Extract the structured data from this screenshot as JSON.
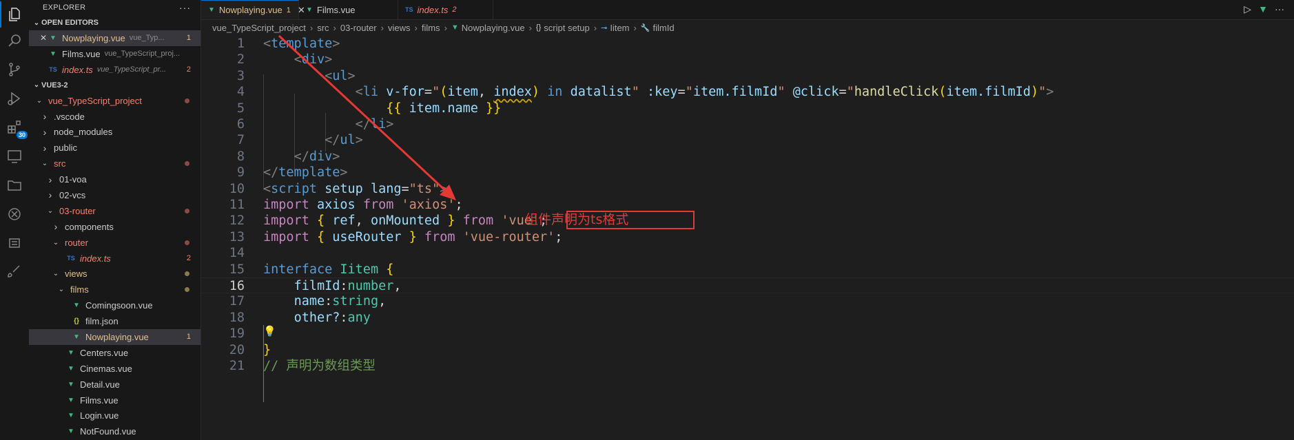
{
  "explorer": {
    "title": "EXPLORER",
    "more": "···",
    "open_editors_title": "OPEN EDITORS",
    "open_editors": [
      {
        "name": "Nowplaying.vue",
        "desc": "vue_Typ...",
        "count": "1",
        "icon": "vue-icon",
        "status": "mod",
        "close": "✕"
      },
      {
        "name": "Films.vue",
        "desc": "vue_TypeScript_proj...",
        "count": "",
        "icon": "vue-icon",
        "status": "none"
      },
      {
        "name": "index.ts",
        "desc": "vue_TypeScript_pr...",
        "count": "2",
        "icon": "ts-icon",
        "status": "err"
      }
    ],
    "workspace_title": "VUE3-2",
    "tree": [
      {
        "name": "vue_TypeScript_project",
        "depth": 0,
        "twist": "v",
        "color": "err",
        "marker": "dot"
      },
      {
        "name": ".vscode",
        "depth": 1,
        "twist": ">",
        "color": "none"
      },
      {
        "name": "node_modules",
        "depth": 1,
        "twist": ">",
        "color": "none"
      },
      {
        "name": "public",
        "depth": 1,
        "twist": ">",
        "color": "none"
      },
      {
        "name": "src",
        "depth": 1,
        "twist": "v",
        "color": "err",
        "marker": "dot"
      },
      {
        "name": "01-voa",
        "depth": 2,
        "twist": ">",
        "color": "none"
      },
      {
        "name": "02-vcs",
        "depth": 2,
        "twist": ">",
        "color": "none"
      },
      {
        "name": "03-router",
        "depth": 2,
        "twist": "v",
        "color": "err",
        "marker": "dot"
      },
      {
        "name": "components",
        "depth": 3,
        "twist": ">",
        "color": "none"
      },
      {
        "name": "router",
        "depth": 3,
        "twist": "v",
        "color": "err",
        "marker": "dot"
      },
      {
        "name": "index.ts",
        "depth": 4,
        "twist": "",
        "icon": "ts-icon",
        "color": "err",
        "count": "2"
      },
      {
        "name": "views",
        "depth": 3,
        "twist": "v",
        "color": "mod",
        "marker": "dot-mod"
      },
      {
        "name": "films",
        "depth": 4,
        "twist": "v",
        "color": "mod",
        "marker": "dot-mod"
      },
      {
        "name": "Comingsoon.vue",
        "depth": 5,
        "twist": "",
        "icon": "vue-icon",
        "color": "none"
      },
      {
        "name": "film.json",
        "depth": 5,
        "twist": "",
        "icon": "json-icon",
        "color": "none"
      },
      {
        "name": "Nowplaying.vue",
        "depth": 5,
        "twist": "",
        "icon": "vue-icon",
        "color": "mod",
        "count": "1",
        "selected": true
      },
      {
        "name": "Centers.vue",
        "depth": 4,
        "twist": "",
        "icon": "vue-icon",
        "color": "none"
      },
      {
        "name": "Cinemas.vue",
        "depth": 4,
        "twist": "",
        "icon": "vue-icon",
        "color": "none"
      },
      {
        "name": "Detail.vue",
        "depth": 4,
        "twist": "",
        "icon": "vue-icon",
        "color": "none"
      },
      {
        "name": "Films.vue",
        "depth": 4,
        "twist": "",
        "icon": "vue-icon",
        "color": "none"
      },
      {
        "name": "Login.vue",
        "depth": 4,
        "twist": "",
        "icon": "vue-icon",
        "color": "none"
      },
      {
        "name": "NotFound.vue",
        "depth": 4,
        "twist": "",
        "icon": "vue-icon",
        "color": "none"
      }
    ]
  },
  "activity_bar": {
    "icons": [
      "files-icon",
      "search-icon",
      "source-control-icon",
      "run-debug-icon",
      "extensions-icon",
      "remote-explorer-icon",
      "folder-icon",
      "openai-icon",
      "list-icon",
      "brush-icon"
    ],
    "extensions_badge": "30"
  },
  "tabs": [
    {
      "label": "Nowplaying.vue",
      "count": "1",
      "close": "✕",
      "icon": "vue-icon",
      "active": true,
      "status": "mod"
    },
    {
      "label": "Films.vue",
      "count": "",
      "icon": "vue-icon",
      "active": false,
      "status": "none"
    },
    {
      "label": "index.ts",
      "count": "2",
      "icon": "ts-icon",
      "active": false,
      "status": "err"
    }
  ],
  "breadcrumb": [
    "vue_TypeScript_project",
    "src",
    "03-router",
    "views",
    "films",
    "Nowplaying.vue",
    "script setup",
    "Iitem",
    "filmId"
  ],
  "editor": {
    "current_line": 16,
    "lines": [
      {
        "n": "1",
        "tokens": [
          [
            "t-br",
            "<"
          ],
          [
            "t-tag",
            "template"
          ],
          [
            "t-br",
            ">"
          ]
        ]
      },
      {
        "n": "2",
        "tokens": [
          [
            "",
            "    "
          ],
          [
            "t-br",
            "<"
          ],
          [
            "t-tag",
            "div"
          ],
          [
            "t-br",
            ">"
          ]
        ]
      },
      {
        "n": "3",
        "tokens": [
          [
            "",
            "        "
          ],
          [
            "t-br",
            "<"
          ],
          [
            "t-tag",
            "ul"
          ],
          [
            "t-br",
            ">"
          ]
        ]
      },
      {
        "n": "4",
        "tokens": [
          [
            "",
            "            "
          ],
          [
            "t-br",
            "<"
          ],
          [
            "t-tag",
            "li"
          ],
          [
            "",
            " "
          ],
          [
            "t-attr",
            "v-for"
          ],
          [
            "",
            "="
          ],
          [
            "t-str",
            "\""
          ],
          [
            "t-p1",
            "("
          ],
          [
            "t-attr",
            "item"
          ],
          [
            "",
            ", "
          ],
          [
            "t-attr t-warn",
            "index"
          ],
          [
            "t-p1",
            ")"
          ],
          [
            "",
            " "
          ],
          [
            "t-kwb",
            "in"
          ],
          [
            "",
            " "
          ],
          [
            "t-attr",
            "datalist"
          ],
          [
            "t-str",
            "\""
          ],
          [
            "",
            " "
          ],
          [
            "t-attr",
            ":key"
          ],
          [
            "",
            "="
          ],
          [
            "t-str",
            "\""
          ],
          [
            "t-attr",
            "item.filmId"
          ],
          [
            "t-str",
            "\""
          ],
          [
            "",
            " "
          ],
          [
            "t-attr",
            "@click"
          ],
          [
            "",
            "="
          ],
          [
            "t-str",
            "\""
          ],
          [
            "t-fn",
            "handleClick"
          ],
          [
            "t-p1",
            "("
          ],
          [
            "t-attr",
            "item.filmId"
          ],
          [
            "t-p1",
            ")"
          ],
          [
            "t-str",
            "\""
          ],
          [
            "t-br",
            ">"
          ]
        ]
      },
      {
        "n": "5",
        "tokens": [
          [
            "",
            "                "
          ],
          [
            "t-p1",
            "{{"
          ],
          [
            "",
            " "
          ],
          [
            "t-attr",
            "item.name"
          ],
          [
            "",
            " "
          ],
          [
            "t-p1",
            "}}"
          ]
        ]
      },
      {
        "n": "6",
        "tokens": [
          [
            "",
            "            "
          ],
          [
            "t-br",
            "</"
          ],
          [
            "t-tag",
            "li"
          ],
          [
            "t-br",
            ">"
          ]
        ]
      },
      {
        "n": "7",
        "tokens": [
          [
            "",
            "        "
          ],
          [
            "t-br",
            "</"
          ],
          [
            "t-tag",
            "ul"
          ],
          [
            "t-br",
            ">"
          ]
        ]
      },
      {
        "n": "8",
        "tokens": [
          [
            "",
            "    "
          ],
          [
            "t-br",
            "</"
          ],
          [
            "t-tag",
            "div"
          ],
          [
            "t-br",
            ">"
          ]
        ]
      },
      {
        "n": "9",
        "tokens": [
          [
            "t-br",
            "</"
          ],
          [
            "t-tag",
            "template"
          ],
          [
            "t-br",
            ">"
          ]
        ]
      },
      {
        "n": "10",
        "tokens": [
          [
            "t-br",
            "<"
          ],
          [
            "t-tag",
            "script"
          ],
          [
            "",
            " "
          ],
          [
            "t-attr",
            "setup"
          ],
          [
            "",
            " "
          ],
          [
            "t-attr",
            "lang"
          ],
          [
            "",
            "="
          ],
          [
            "t-str",
            "\"ts\""
          ],
          [
            "t-br",
            ">"
          ]
        ]
      },
      {
        "n": "11",
        "tokens": [
          [
            "t-kw",
            "import"
          ],
          [
            "",
            " "
          ],
          [
            "t-attr",
            "axios"
          ],
          [
            "",
            " "
          ],
          [
            "t-kw",
            "from"
          ],
          [
            "",
            " "
          ],
          [
            "t-str",
            "'axios'"
          ],
          [
            "",
            ";"
          ]
        ]
      },
      {
        "n": "12",
        "tokens": [
          [
            "t-kw",
            "import"
          ],
          [
            "",
            " "
          ],
          [
            "t-p1",
            "{"
          ],
          [
            "",
            " "
          ],
          [
            "t-attr",
            "ref"
          ],
          [
            "",
            ", "
          ],
          [
            "t-attr",
            "onMounted"
          ],
          [
            "",
            " "
          ],
          [
            "t-p1",
            "}"
          ],
          [
            "",
            " "
          ],
          [
            "t-kw",
            "from"
          ],
          [
            "",
            " "
          ],
          [
            "t-str",
            "'vue'"
          ],
          [
            "",
            ";"
          ]
        ]
      },
      {
        "n": "13",
        "tokens": [
          [
            "t-kw",
            "import"
          ],
          [
            "",
            " "
          ],
          [
            "t-p1",
            "{"
          ],
          [
            "",
            " "
          ],
          [
            "t-attr",
            "useRouter"
          ],
          [
            "",
            " "
          ],
          [
            "t-p1",
            "}"
          ],
          [
            "",
            " "
          ],
          [
            "t-kw",
            "from"
          ],
          [
            "",
            " "
          ],
          [
            "t-str",
            "'vue-router'"
          ],
          [
            "",
            ";"
          ]
        ]
      },
      {
        "n": "14",
        "tokens": []
      },
      {
        "n": "15",
        "tokens": [
          [
            "t-kwb",
            "interface"
          ],
          [
            "",
            " "
          ],
          [
            "t-ty",
            "Iitem"
          ],
          [
            "",
            " "
          ],
          [
            "t-p1",
            "{"
          ]
        ]
      },
      {
        "n": "16",
        "tokens": [
          [
            "",
            "    "
          ],
          [
            "t-attr",
            "filmId"
          ],
          [
            "",
            ":"
          ],
          [
            "t-ty",
            "number"
          ],
          [
            "",
            ","
          ]
        ]
      },
      {
        "n": "17",
        "tokens": [
          [
            "",
            "    "
          ],
          [
            "t-attr",
            "name"
          ],
          [
            "",
            ":"
          ],
          [
            "t-ty",
            "string"
          ],
          [
            "",
            ","
          ]
        ]
      },
      {
        "n": "18",
        "tokens": [
          [
            "",
            "    "
          ],
          [
            "t-attr",
            "other?"
          ],
          [
            "",
            ":"
          ],
          [
            "t-ty",
            "any"
          ]
        ]
      },
      {
        "n": "19",
        "tokens": []
      },
      {
        "n": "20",
        "tokens": [
          [
            "t-p1",
            "}"
          ]
        ]
      },
      {
        "n": "21",
        "tokens": [
          [
            "t-cm",
            "// 声明为数组类型"
          ]
        ]
      }
    ]
  },
  "annotation": {
    "text": "组件声明为ts格式",
    "color": "#e53935"
  }
}
